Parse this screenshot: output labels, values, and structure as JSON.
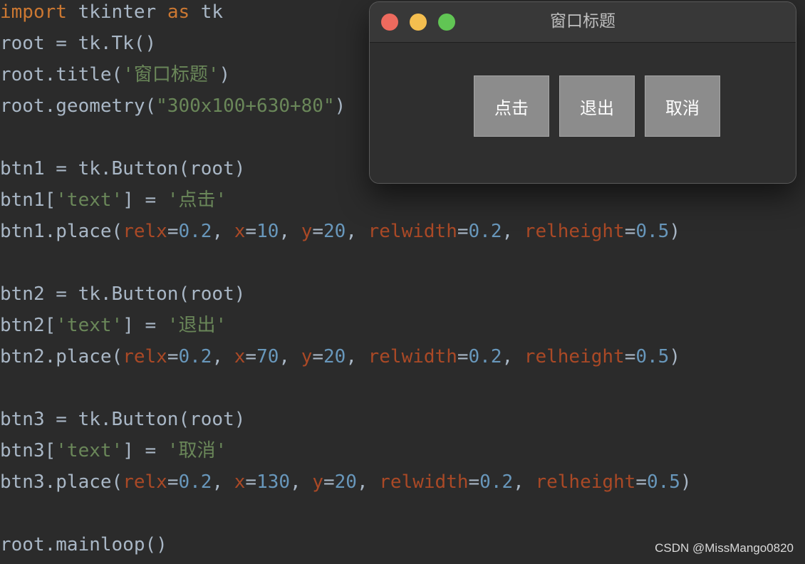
{
  "editor": {
    "lines": [
      [
        {
          "t": "import ",
          "c": "kw"
        },
        {
          "t": "tkinter ",
          "c": "plain"
        },
        {
          "t": "as ",
          "c": "kw"
        },
        {
          "t": "tk",
          "c": "plain"
        }
      ],
      [
        {
          "t": "root = tk.Tk()",
          "c": "plain"
        }
      ],
      [
        {
          "t": "root.title(",
          "c": "plain"
        },
        {
          "t": "'窗口标题'",
          "c": "str"
        },
        {
          "t": ")",
          "c": "plain"
        }
      ],
      [
        {
          "t": "root.geometry(",
          "c": "plain"
        },
        {
          "t": "\"300x100+630+80\"",
          "c": "str"
        },
        {
          "t": ")",
          "c": "plain"
        }
      ],
      [],
      [
        {
          "t": "btn1 = tk.Button(root)",
          "c": "plain"
        }
      ],
      [
        {
          "t": "btn1[",
          "c": "plain"
        },
        {
          "t": "'text'",
          "c": "str"
        },
        {
          "t": "] = ",
          "c": "plain"
        },
        {
          "t": "'点击'",
          "c": "str"
        }
      ],
      [
        {
          "t": "btn1.place(",
          "c": "plain"
        },
        {
          "t": "relx",
          "c": "param"
        },
        {
          "t": "=",
          "c": "plain"
        },
        {
          "t": "0.2",
          "c": "num"
        },
        {
          "t": ", ",
          "c": "plain"
        },
        {
          "t": "x",
          "c": "param"
        },
        {
          "t": "=",
          "c": "plain"
        },
        {
          "t": "10",
          "c": "num"
        },
        {
          "t": ", ",
          "c": "plain"
        },
        {
          "t": "y",
          "c": "param"
        },
        {
          "t": "=",
          "c": "plain"
        },
        {
          "t": "20",
          "c": "num"
        },
        {
          "t": ", ",
          "c": "plain"
        },
        {
          "t": "relwidth",
          "c": "param"
        },
        {
          "t": "=",
          "c": "plain"
        },
        {
          "t": "0.2",
          "c": "num"
        },
        {
          "t": ", ",
          "c": "plain"
        },
        {
          "t": "relheight",
          "c": "param"
        },
        {
          "t": "=",
          "c": "plain"
        },
        {
          "t": "0.5",
          "c": "num"
        },
        {
          "t": ")",
          "c": "plain"
        }
      ],
      [],
      [
        {
          "t": "btn2 = tk.Button(root)",
          "c": "plain"
        }
      ],
      [
        {
          "t": "btn2[",
          "c": "plain"
        },
        {
          "t": "'text'",
          "c": "str"
        },
        {
          "t": "] = ",
          "c": "plain"
        },
        {
          "t": "'退出'",
          "c": "str"
        }
      ],
      [
        {
          "t": "btn2.place(",
          "c": "plain"
        },
        {
          "t": "relx",
          "c": "param"
        },
        {
          "t": "=",
          "c": "plain"
        },
        {
          "t": "0.2",
          "c": "num"
        },
        {
          "t": ", ",
          "c": "plain"
        },
        {
          "t": "x",
          "c": "param"
        },
        {
          "t": "=",
          "c": "plain"
        },
        {
          "t": "70",
          "c": "num"
        },
        {
          "t": ", ",
          "c": "plain"
        },
        {
          "t": "y",
          "c": "param"
        },
        {
          "t": "=",
          "c": "plain"
        },
        {
          "t": "20",
          "c": "num"
        },
        {
          "t": ", ",
          "c": "plain"
        },
        {
          "t": "relwidth",
          "c": "param"
        },
        {
          "t": "=",
          "c": "plain"
        },
        {
          "t": "0.2",
          "c": "num"
        },
        {
          "t": ", ",
          "c": "plain"
        },
        {
          "t": "relheight",
          "c": "param"
        },
        {
          "t": "=",
          "c": "plain"
        },
        {
          "t": "0.5",
          "c": "num"
        },
        {
          "t": ")",
          "c": "plain"
        }
      ],
      [],
      [
        {
          "t": "btn3 = tk.Button(root)",
          "c": "plain"
        }
      ],
      [
        {
          "t": "btn3[",
          "c": "plain"
        },
        {
          "t": "'text'",
          "c": "str"
        },
        {
          "t": "] = ",
          "c": "plain"
        },
        {
          "t": "'取消'",
          "c": "str"
        }
      ],
      [
        {
          "t": "btn3.place(",
          "c": "plain"
        },
        {
          "t": "relx",
          "c": "param"
        },
        {
          "t": "=",
          "c": "plain"
        },
        {
          "t": "0.2",
          "c": "num"
        },
        {
          "t": ", ",
          "c": "plain"
        },
        {
          "t": "x",
          "c": "param"
        },
        {
          "t": "=",
          "c": "plain"
        },
        {
          "t": "130",
          "c": "num"
        },
        {
          "t": ", ",
          "c": "plain"
        },
        {
          "t": "y",
          "c": "param"
        },
        {
          "t": "=",
          "c": "plain"
        },
        {
          "t": "20",
          "c": "num"
        },
        {
          "t": ", ",
          "c": "plain"
        },
        {
          "t": "relwidth",
          "c": "param"
        },
        {
          "t": "=",
          "c": "plain"
        },
        {
          "t": "0.2",
          "c": "num"
        },
        {
          "t": ", ",
          "c": "plain"
        },
        {
          "t": "relheight",
          "c": "param"
        },
        {
          "t": "=",
          "c": "plain"
        },
        {
          "t": "0.5",
          "c": "num"
        },
        {
          "t": ")",
          "c": "plain"
        }
      ],
      [],
      [
        {
          "t": "root.mainloop()",
          "c": "plain"
        }
      ]
    ]
  },
  "window": {
    "title": "窗口标题",
    "buttons": [
      {
        "label": "点击"
      },
      {
        "label": "退出"
      },
      {
        "label": "取消"
      }
    ]
  },
  "watermark": "CSDN @MissMango0820",
  "colors": {
    "background": "#2b2b2b",
    "plain": "#a9b7c6",
    "keyword": "#cc7832",
    "string": "#6a8759",
    "number": "#6897bb",
    "param": "#aa4926",
    "tk_button": "#8c8c8c"
  }
}
